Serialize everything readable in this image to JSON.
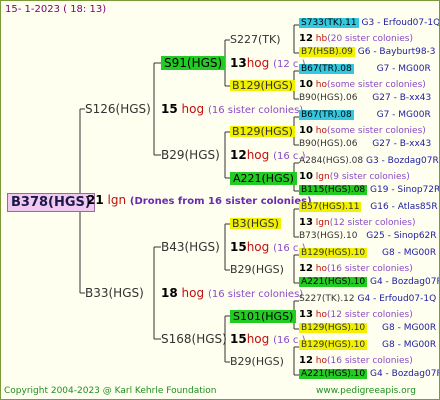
{
  "header": {
    "date": "15-  1-2023 ( 18: 13)"
  },
  "root": {
    "label": "B378(HGS)"
  },
  "root_colonies": {
    "count": "21",
    "word": "lgn",
    "note": "(Drones from 16 sister colonies)"
  },
  "gen1": [
    {
      "label": "S126(HGS)",
      "count": "15",
      "hog": "hog",
      "note": "(16 sister colonies)"
    },
    {
      "label": "B33(HGS)",
      "count": "18",
      "hog": "hog",
      "note": "(16 sister colonies)"
    }
  ],
  "gen2": [
    {
      "label": "S91(HGS)",
      "count": "13",
      "hog": "hog",
      "note": "(12 c.)"
    },
    {
      "label": "B29(HGS)",
      "count": "12",
      "hog": "hog",
      "note": "(16 c.)"
    },
    {
      "label": "B43(HGS)",
      "count": "15",
      "hog": "hog",
      "note": "(16 c.)"
    },
    {
      "label": "S168(HGS)",
      "count": "15",
      "hog": "hog",
      "note": "(16 c.)"
    }
  ],
  "gen3": [
    {
      "label": "S227(TK)"
    },
    {
      "label": "B129(HGS)"
    },
    {
      "label": "B129(HGS)"
    },
    {
      "label": "A221(HGS)"
    },
    {
      "label": "B3(HGS)"
    },
    {
      "label": "B29(HGS)"
    },
    {
      "label": "S101(HGS)"
    },
    {
      "label": "B29(HGS)"
    }
  ],
  "gen3_colonies": [
    {
      "count": "13",
      "hog": "hog",
      "note": "(12 c.)"
    },
    {
      "count": "12",
      "hog": "hog",
      "note": "(16 c.)"
    },
    {
      "count": "15",
      "hog": "hog",
      "note": "(16 c.)"
    },
    {
      "count": "15",
      "hog": "hog",
      "note": "(16 c.)"
    }
  ],
  "gen4": [
    {
      "label": "S733(TK).11",
      "ann": "G3 - Erfoud07-1Q"
    },
    {
      "count": "12",
      "hog": "hb",
      "note": "(20 sister colonies)"
    },
    {
      "label": "B7(HSB).09",
      "ann": "G6 - Bayburt98-3"
    },
    {
      "label": "B67(TR).08",
      "ann": "G7 - MG00R"
    },
    {
      "count": "10",
      "hog": "ho",
      "note": "(some sister colonies)"
    },
    {
      "label": "B90(HGS).06",
      "ann": "G27 - B-xx43"
    },
    {
      "label": "B67(TR).08",
      "ann": "G7 - MG00R"
    },
    {
      "count": "10",
      "hog": "ho",
      "note": "(some sister colonies)"
    },
    {
      "label": "B90(HGS).06",
      "ann": "G27 - B-xx43"
    },
    {
      "label": "A284(HGS).08",
      "ann": "G3 - Bozdag07R"
    },
    {
      "count": "10",
      "hog": "lgn",
      "note": "(9 sister colonies)"
    },
    {
      "label": "B115(HGS).08",
      "ann": "G19 - Sinop72R"
    },
    {
      "label": "B57(HGS).11",
      "ann": "G16 - Atlas85R"
    },
    {
      "count": "13",
      "hog": "lgn",
      "note": "(12 sister colonies)"
    },
    {
      "label": "B73(HGS).10",
      "ann": "G25 - Sinop62R"
    },
    {
      "label": "B129(HGS).10",
      "ann": "G8 - MG00R"
    },
    {
      "count": "12",
      "hog": "ho",
      "note": "(16 sister colonies)"
    },
    {
      "label": "A221(HGS).10",
      "ann": "G4 - Bozdag07R"
    },
    {
      "label": "S227(TK).12",
      "ann": "G4 - Erfoud07-1Q"
    },
    {
      "count": "13",
      "hog": "ho",
      "note": "(12 sister colonies)"
    },
    {
      "label": "B129(HGS).10",
      "ann": "G8 - MG00R"
    },
    {
      "label": "B129(HGS).10",
      "ann": "G8 - MG00R"
    },
    {
      "count": "12",
      "hog": "ho",
      "note": "(16 sister colonies)"
    },
    {
      "label": "A221(HGS).10",
      "ann": "G4 - Bozdag07R"
    }
  ],
  "footer": {
    "copyright": "Copyright 2004-2023 @ Karl Kehrle Foundation",
    "site": "www.pedigreeapis.org"
  }
}
